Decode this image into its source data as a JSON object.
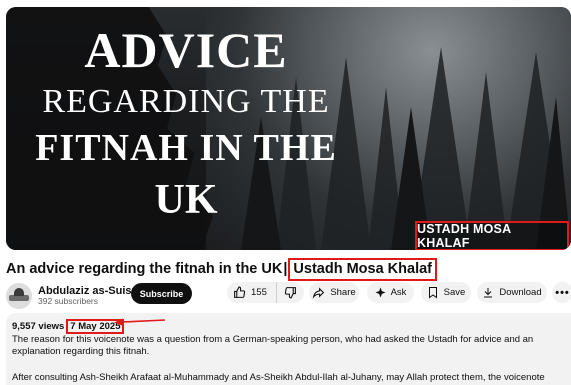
{
  "thumbnail": {
    "headline_line1": "ADVICE",
    "headline_line2": "REGARDING THE",
    "headline_line3": "FITNAH IN THE",
    "headline_line4": "UK",
    "speaker_label": "USTADH MOSA KHALAF"
  },
  "video": {
    "title_main": "An advice regarding the fitnah in the UK",
    "title_separator": "|",
    "title_speaker": "Ustadh Mosa Khalaf"
  },
  "channel": {
    "name": "Abdulaziz as-Suisri",
    "subscribers": "392 subscribers",
    "subscribe_label": "Subscribe"
  },
  "actions": {
    "like_count": "155",
    "share_label": "Share",
    "ask_label": "Ask",
    "save_label": "Save",
    "download_label": "Download",
    "more_label": "•••"
  },
  "description": {
    "views": "9,557 views",
    "date": "7 May 2025",
    "paragraph1": "The reason for this voicenote was a question from a German-speaking person, who had asked the Ustadh for advice and an explanation regarding this fitnah.",
    "paragraph2": "After consulting Ash-Sheikh Arafaat al-Muhammady and As-Sheikh Abdul-Ilah al-Juhany, may Allah protect them, the voicenote was recorded."
  },
  "colors": {
    "highlight": "#e11919",
    "subscribe_bg": "#0f0f0f",
    "pill_bg": "#f2f2f2"
  }
}
